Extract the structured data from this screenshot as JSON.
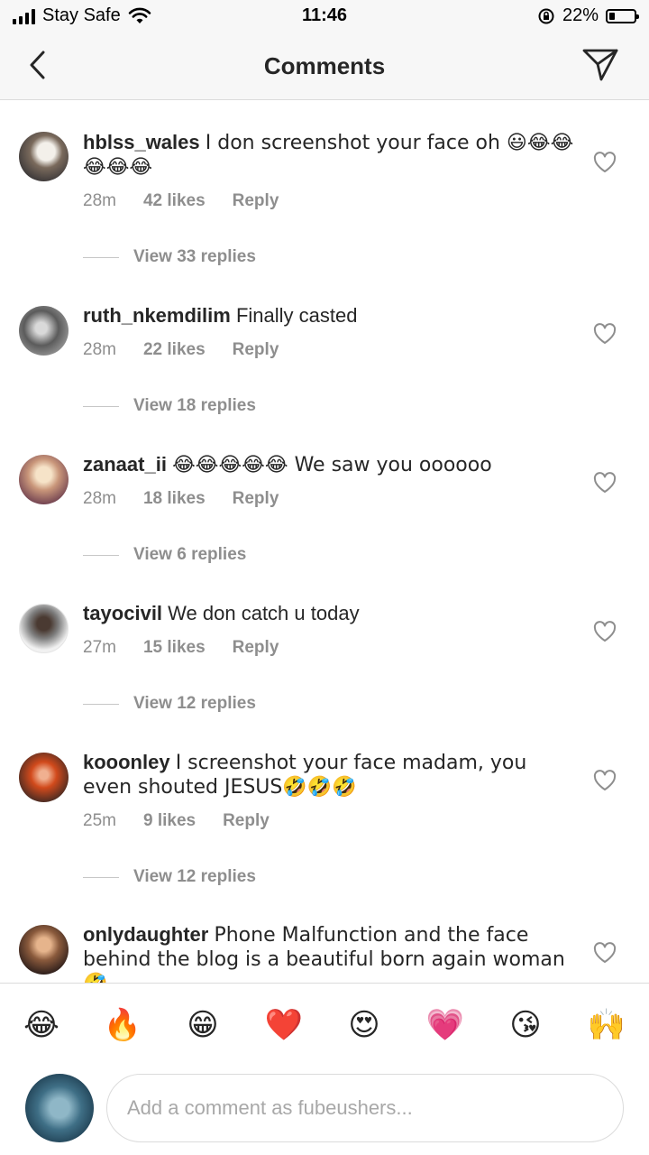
{
  "status_bar": {
    "carrier": "Stay Safe",
    "time": "11:46",
    "battery": "22%",
    "battery_level": 0.22
  },
  "header": {
    "title": "Comments",
    "back_icon": "chevron-left-icon",
    "share_icon": "direct-send-icon"
  },
  "comments": [
    {
      "username": "hblss_wales",
      "text": "I don screenshot your face oh 😃😂😂😂😂😂",
      "time": "28m",
      "likes": "42 likes",
      "reply": "Reply",
      "view_replies": "View 33 replies"
    },
    {
      "username": "ruth_nkemdilim",
      "text": "Finally casted",
      "time": "28m",
      "likes": "22 likes",
      "reply": "Reply",
      "view_replies": "View 18 replies"
    },
    {
      "username": "zanaat_ii",
      "text": "😂😂😂😂😂 We saw you oooooo",
      "time": "28m",
      "likes": "18 likes",
      "reply": "Reply",
      "view_replies": "View 6 replies"
    },
    {
      "username": "tayocivil",
      "text": "We don catch u today",
      "time": "27m",
      "likes": "15 likes",
      "reply": "Reply",
      "view_replies": "View 12 replies"
    },
    {
      "username": "kooonley",
      "text": "I screenshot your face madam, you even shouted JESUS🤣🤣🤣",
      "time": "25m",
      "likes": "9 likes",
      "reply": "Reply",
      "view_replies": "View 12 replies"
    },
    {
      "username": "onlydaughter",
      "text": "Phone Malfunction and the face behind the blog is a beautiful born again woman 🤣"
    }
  ],
  "quick_emojis": [
    "😂",
    "🔥",
    "😁",
    "❤️",
    "😍",
    "💗",
    "😘",
    "🙌"
  ],
  "composer": {
    "placeholder": "Add a comment as fubeushers..."
  },
  "colors": {
    "text": "#262626",
    "secondary": "#8e8e8e",
    "divider": "#dbdbdb",
    "bar_bg": "#f7f7f7"
  }
}
